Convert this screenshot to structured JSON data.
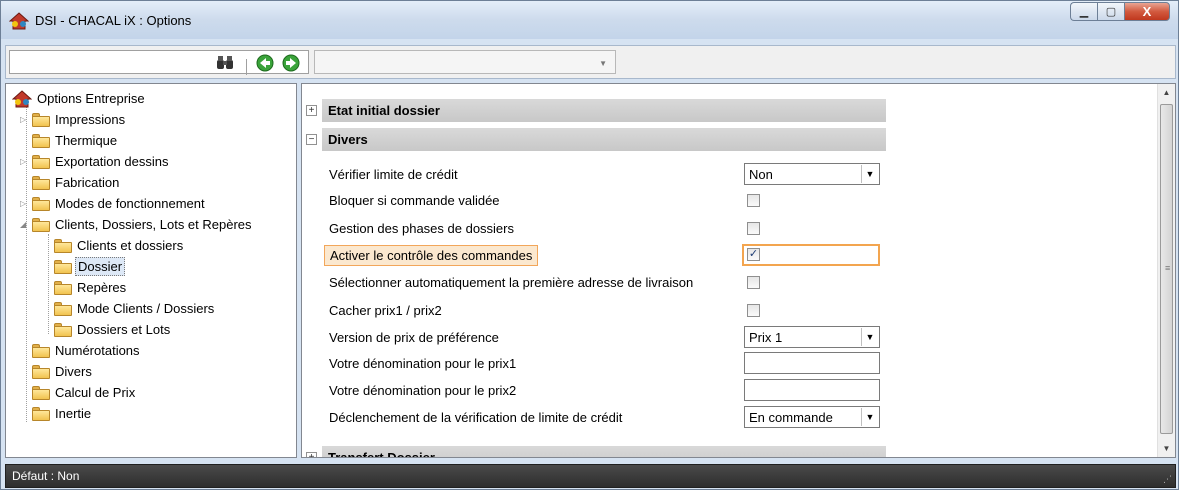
{
  "window": {
    "title": "DSI - CHACAL iX : Options",
    "minimize_icon": "minimize-icon",
    "maximize_icon": "maximize-icon",
    "close_icon": "close-icon",
    "minimize_glyph": "▁",
    "maximize_glyph": "▢",
    "close_glyph": "X"
  },
  "toolbar": {
    "search_value": "",
    "combo_value": "",
    "icons": [
      "binoculars-icon",
      "back-arrow-icon",
      "forward-arrow-icon"
    ],
    "combo_arrow": "▼"
  },
  "tree": {
    "root": "Options Entreprise",
    "items": [
      {
        "label": "Impressions",
        "expander": "▷"
      },
      {
        "label": "Thermique",
        "expander": ""
      },
      {
        "label": "Exportation dessins",
        "expander": "▷"
      },
      {
        "label": "Fabrication",
        "expander": ""
      },
      {
        "label": "Modes de fonctionnement",
        "expander": "▷"
      },
      {
        "label": "Clients, Dossiers, Lots et Repères",
        "expander": "◢"
      },
      {
        "label": "Clients et dossiers",
        "expander": ""
      },
      {
        "label": "Dossier",
        "expander": ""
      },
      {
        "label": "Repères",
        "expander": ""
      },
      {
        "label": "Mode Clients / Dossiers",
        "expander": ""
      },
      {
        "label": "Dossiers et Lots",
        "expander": ""
      },
      {
        "label": "Numérotations",
        "expander": ""
      },
      {
        "label": "Divers",
        "expander": ""
      },
      {
        "label": "Calcul de Prix",
        "expander": ""
      },
      {
        "label": "Inertie",
        "expander": ""
      }
    ],
    "selected": "Dossier"
  },
  "props": {
    "groups": {
      "etat_initial": {
        "label": "Etat initial dossier",
        "toggle": "+"
      },
      "divers": {
        "label": "Divers",
        "toggle": "−"
      },
      "transfert": {
        "label": "Transfert Dossier",
        "toggle": "+"
      }
    },
    "rows": [
      {
        "label": "Vérifier limite de crédit",
        "type": "combo",
        "value": "Non"
      },
      {
        "label": "Bloquer si commande validée",
        "type": "checkbox",
        "checked": false
      },
      {
        "label": "Gestion des phases de dossiers",
        "type": "checkbox",
        "checked": false
      },
      {
        "label": "Activer le contrôle des commandes",
        "type": "checkbox",
        "checked": true
      },
      {
        "label": "Sélectionner automatiquement la première adresse de livraison",
        "type": "checkbox",
        "checked": false
      },
      {
        "label": "Cacher prix1 / prix2",
        "type": "checkbox",
        "checked": false
      },
      {
        "label": "Version de prix de préférence",
        "type": "combo",
        "value": "Prix 1"
      },
      {
        "label": "Votre dénomination pour le prix1",
        "type": "text",
        "value": ""
      },
      {
        "label": "Votre dénomination pour le prix2",
        "type": "text",
        "value": ""
      },
      {
        "label": "Déclenchement de la vérification de limite de crédit",
        "type": "combo",
        "value": "En commande"
      }
    ],
    "check_glyph": "✓",
    "combo_arrow": "▼",
    "scroll_up": "▲",
    "scroll_down": "▼",
    "scroll_grip": "≡"
  },
  "status": {
    "text": "Défaut : Non"
  },
  "colors": {
    "highlight_border": "#f3a54f",
    "highlight_fill": "#fbe8cf",
    "statusbar": "#3a3a3a"
  }
}
